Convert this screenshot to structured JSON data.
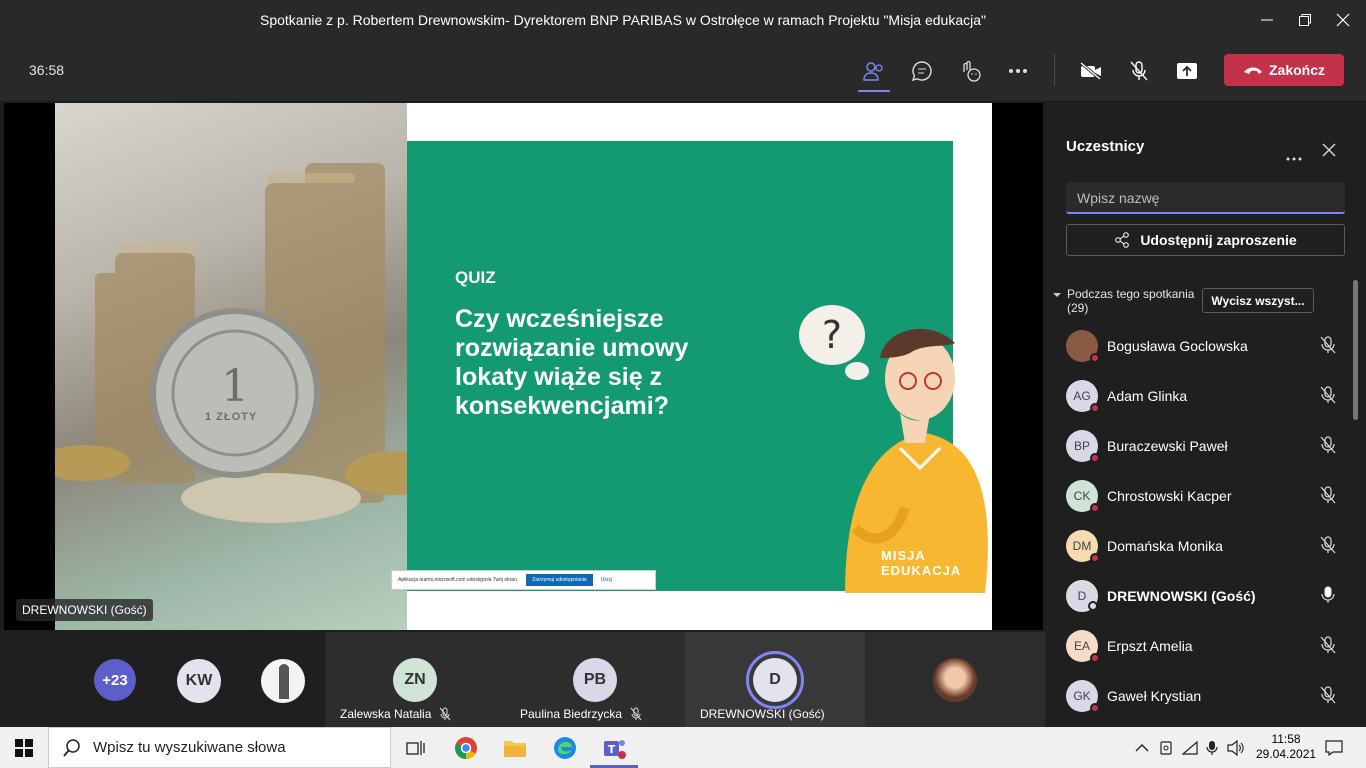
{
  "window": {
    "title": "Spotkanie z p. Robertem Drewnowskim- Dyrektorem BNP PARIBAS w Ostrołęce w ramach Projektu \"Misja edukacja\""
  },
  "toolbar": {
    "timer": "36:58",
    "end_label": "Zakończ",
    "accent": "#c4314b"
  },
  "slide": {
    "quiz_label": "QUIZ",
    "question": "Czy wcześniejsze rozwiązanie umowy lokaty wiąże się z konsekwencjami?",
    "coin_text": "1 ZŁOTY",
    "thought_mark": "?",
    "logo_line1": "MISJA",
    "logo_line2": "EDUKACJA",
    "share_text": "Aplikacja teams.microsoft.com udostępnia Twój ekran.",
    "share_stop": "Zatrzymaj udostępnianie",
    "share_hide": "Ukryj",
    "presenter_label": "DREWNOWSKI (Gość)"
  },
  "strip": {
    "more_count": "+23",
    "kw_initials": "KW",
    "tiles": [
      {
        "initials": "ZN",
        "name": "Zalewska Natalia"
      },
      {
        "initials": "PB",
        "name": "Paulina Biedrzycka"
      },
      {
        "initials": "D",
        "name": "DREWNOWSKI (Gość)"
      }
    ]
  },
  "panel": {
    "title": "Uczestnicy",
    "search_placeholder": "Wpisz nazwę",
    "invite_label": "Udostępnij zaproszenie",
    "section_label": "Podczas tego spotkania (29)",
    "mute_all_label": "Wycisz wszyst...",
    "participants": [
      {
        "initials": "",
        "name": "Bogusława Goclowska",
        "color": "#8a5a44"
      },
      {
        "initials": "AG",
        "name": "Adam Glinka",
        "color": "#d8d8e8"
      },
      {
        "initials": "BP",
        "name": "Buraczewski Paweł",
        "color": "#d8d8e8"
      },
      {
        "initials": "CK",
        "name": "Chrostowski Kacper",
        "color": "#cfe3d6"
      },
      {
        "initials": "DM",
        "name": "Domańska Monika",
        "color": "#f5dcb0"
      },
      {
        "initials": "D",
        "name": "DREWNOWSKI (Gość)",
        "color": "#d8d8e8"
      },
      {
        "initials": "EA",
        "name": "Erpszt Amelia",
        "color": "#f5dcc8"
      },
      {
        "initials": "GK",
        "name": "Gaweł Krystian",
        "color": "#d8d8e8"
      }
    ]
  },
  "taskbar": {
    "search_placeholder": "Wpisz tu wyszukiwane słowa",
    "time": "11:58",
    "date": "29.04.2021"
  }
}
